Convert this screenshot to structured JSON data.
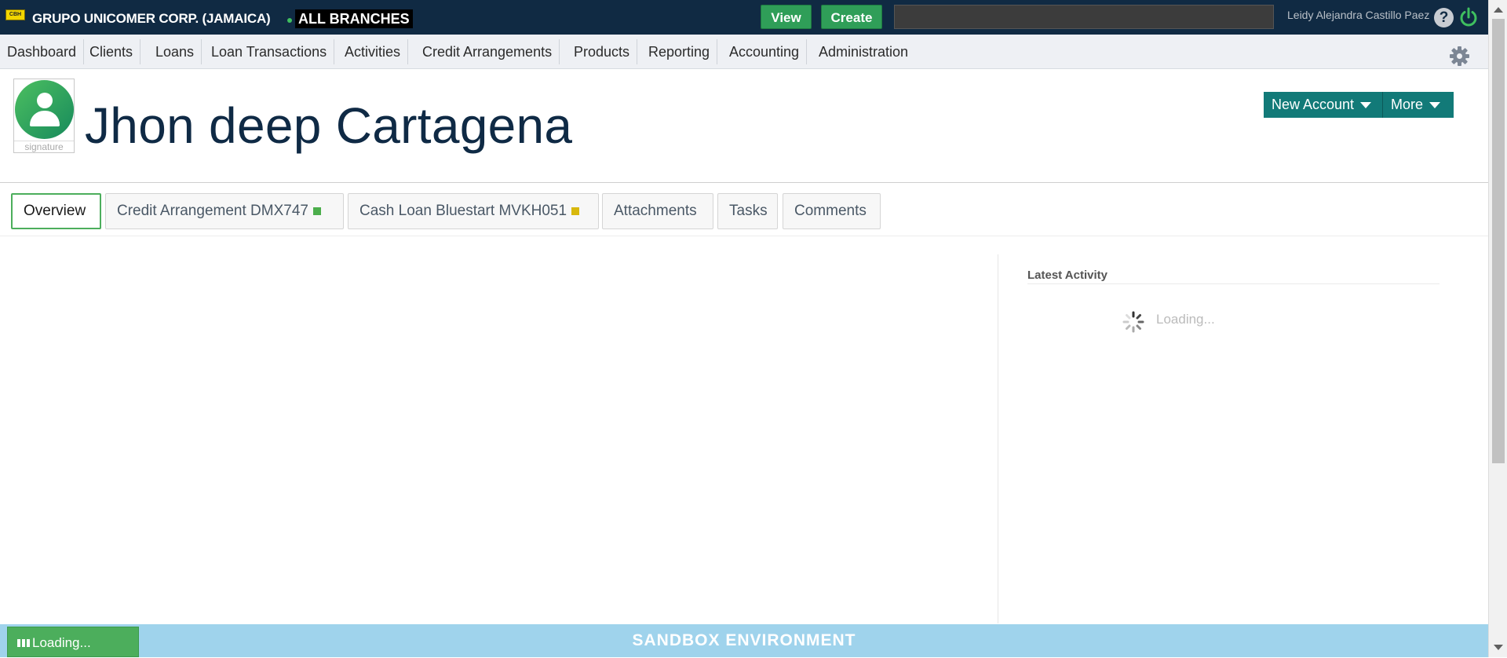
{
  "topbar": {
    "logo_text": "CBH",
    "org_name": "GRUPO UNICOMER CORP. (JAMAICA)",
    "branch": "ALL BRANCHES",
    "view_label": "View",
    "create_label": "Create",
    "search_value": "",
    "user_name": "Leidy Alejandra Castillo Paez",
    "help_symbol": "?"
  },
  "nav": {
    "items": [
      "Dashboard",
      "Clients",
      "Loans",
      "Loan  Transactions",
      "Activities",
      "Credit  Arrangements",
      "Products",
      "Reporting",
      "Accounting",
      "Administration"
    ]
  },
  "client": {
    "signature_label": "signature",
    "name": "Jhon deep Cartagena",
    "new_account_label": "New  Account",
    "more_label": "More"
  },
  "tabs": [
    {
      "label": "Overview",
      "status_color": ""
    },
    {
      "label": "Credit Arrangement DMX747",
      "status_color": "#4cae4c"
    },
    {
      "label": "Cash Loan Bluestart MVKH051",
      "status_color": "#d8b80c"
    },
    {
      "label": "Attachments",
      "status_color": ""
    },
    {
      "label": "Tasks",
      "status_color": ""
    },
    {
      "label": "Comments",
      "status_color": ""
    }
  ],
  "latest_activity": {
    "title": "Latest Activity",
    "loading_text": "Loading..."
  },
  "footer": {
    "environment_label": "SANDBOX ENVIRONMENT",
    "loading_chip_label": "Loading..."
  },
  "colors": {
    "topbar": "#102a43",
    "accent_green": "#2f9e58",
    "teal": "#127a78",
    "footer": "#9fd3ec"
  }
}
